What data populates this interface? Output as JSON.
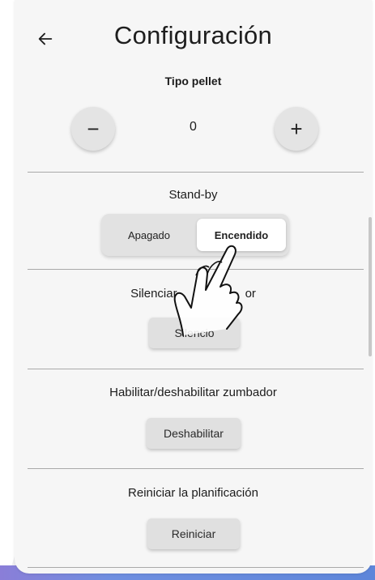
{
  "header": {
    "title": "Configuración",
    "back_icon": "arrow-left-icon"
  },
  "pellet": {
    "label": "Tipo pellet",
    "value": "0",
    "decrement_symbol": "−",
    "increment_symbol": "+"
  },
  "standby": {
    "label": "Stand-by",
    "options": [
      "Apagado",
      "Encendido"
    ],
    "selected": "Encendido"
  },
  "silence": {
    "label_visible_left": "Silenciar",
    "label_visible_right": "or",
    "button_label": "Silencio"
  },
  "buzzer": {
    "label": "Habilitar/deshabilitar zumbador",
    "button_label": "Deshabilitar"
  },
  "reset": {
    "label": "Reiniciar la planificación",
    "button_label": "Reiniciar"
  },
  "overlay": {
    "icon": "tap-hand-icon"
  },
  "colors": {
    "panel_bg": "#f6f6f6",
    "button_bg": "#e0e0e0",
    "divider": "#a9a9a9",
    "accent_bottom": "#6f8fe0"
  }
}
